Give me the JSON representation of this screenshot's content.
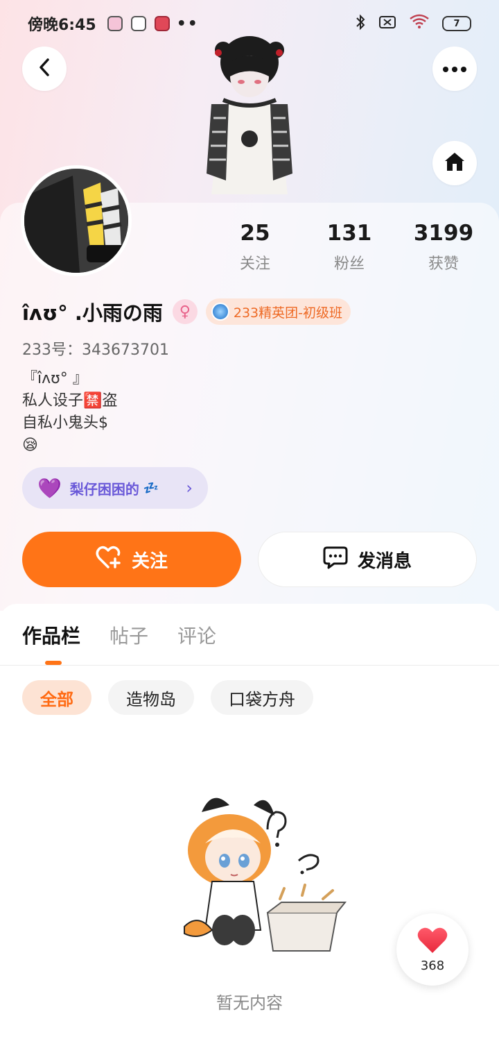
{
  "status_bar": {
    "time": "傍晚6:45",
    "dots": "••",
    "battery": "7"
  },
  "profile": {
    "username": "îʌʊ° .小雨の雨",
    "gender_symbol": "♀",
    "rank_badge": "233精英团-初级班",
    "user_id": "233号：343673701",
    "bio_lines": [
      "『îʌʊ° 』",
      "私人设子🈲盗",
      "自私小鬼头$",
      "😪"
    ],
    "stats": [
      {
        "value": "25",
        "label": "关注"
      },
      {
        "value": "131",
        "label": "粉丝"
      },
      {
        "value": "3199",
        "label": "获赞"
      }
    ],
    "mood": {
      "text": "梨仔困困的",
      "zz": "💤",
      "arrow": "›",
      "heart": "💜"
    }
  },
  "actions": {
    "follow_label": "关注",
    "message_label": "发消息"
  },
  "tabs": [
    {
      "label": "作品栏",
      "active": true
    },
    {
      "label": "帖子",
      "active": false
    },
    {
      "label": "评论",
      "active": false
    }
  ],
  "filters": [
    {
      "label": "全部",
      "active": true
    },
    {
      "label": "造物岛",
      "active": false
    },
    {
      "label": "口袋方舟",
      "active": false
    }
  ],
  "empty_state": {
    "text": "暂无内容"
  },
  "like_widget": {
    "count": "368"
  },
  "colors": {
    "accent": "#ff7417",
    "mood": "#6958d8",
    "rank": "#ee6a25"
  },
  "icons": {
    "back": "chevron-left-icon",
    "more": "more-dots-icon",
    "home": "home-icon",
    "follow": "heart-plus-icon",
    "message": "chat-bubble-icon",
    "like": "heart-icon"
  }
}
